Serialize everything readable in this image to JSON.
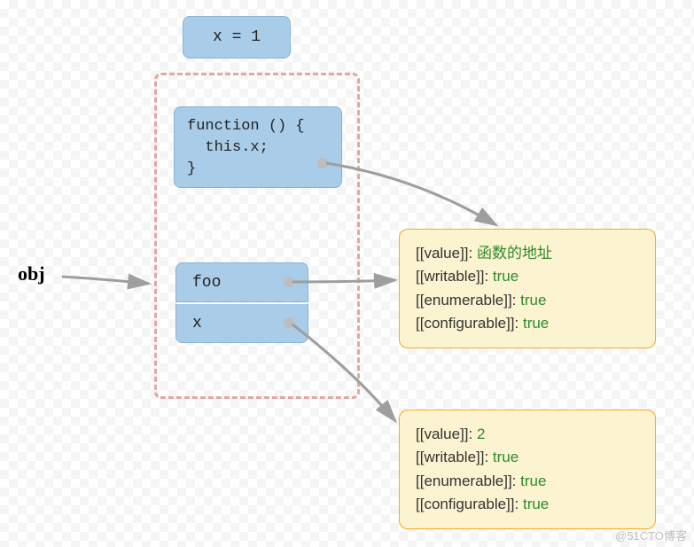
{
  "diagram": {
    "global_var": "x = 1",
    "function_code": "function () {\n  this.x;\n}",
    "obj_label": "obj",
    "props": {
      "foo": "foo",
      "x": "x"
    },
    "descriptor_foo": {
      "value_key": "[[value]]: ",
      "value_val": "函数的地址",
      "writable_key": "[[writable]]: ",
      "writable_val": "true",
      "enumerable_key": "[[enumerable]]: ",
      "enumerable_val": "true",
      "configurable_key": "[[configurable]]: ",
      "configurable_val": "true"
    },
    "descriptor_x": {
      "value_key": "[[value]]: ",
      "value_val": "2",
      "writable_key": "[[writable]]: ",
      "writable_val": "true",
      "enumerable_key": "[[enumerable]]: ",
      "enumerable_val": "true",
      "configurable_key": "[[configurable]]: ",
      "configurable_val": "true"
    },
    "watermark": "@51CTO博客"
  }
}
